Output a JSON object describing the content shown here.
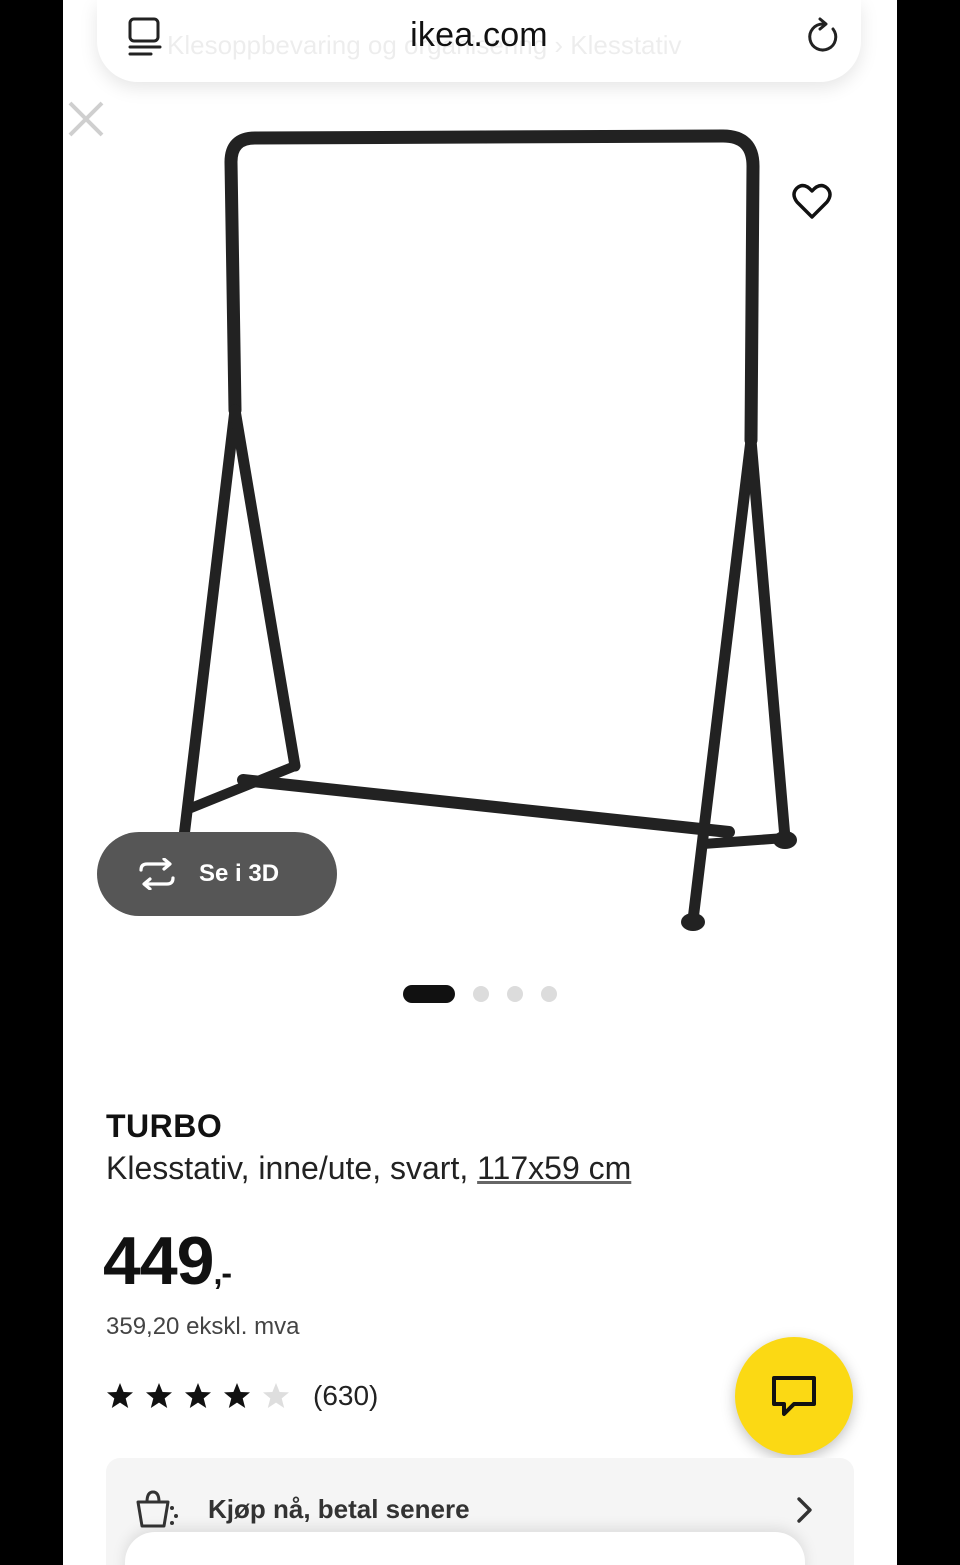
{
  "browser": {
    "domain": "ikea.com",
    "faded_breadcrumb": "Klesoppbevaring og organisering  ›  Klesstativ",
    "icons": {
      "reader": "reader-mode-icon",
      "reload": "reload-icon",
      "close": "close-icon"
    }
  },
  "gallery": {
    "see_3d_label": "Se i 3D",
    "image_count": 4,
    "active_index": 0
  },
  "product": {
    "name": "TURBO",
    "description": "Klesstativ, inne/ute, svart, ",
    "dimensions": "117x59 cm",
    "price": "449",
    "price_suffix": ",-",
    "price_excl_vat": "359,20 ekskl. mva",
    "rating": 4,
    "rating_max": 5,
    "review_count": "(630)"
  },
  "payment": {
    "label": "Kjøp nå, betal senere"
  },
  "colors": {
    "chat_button": "#fbd914",
    "see_3d_bg": "#565656",
    "frame": "#222222"
  }
}
